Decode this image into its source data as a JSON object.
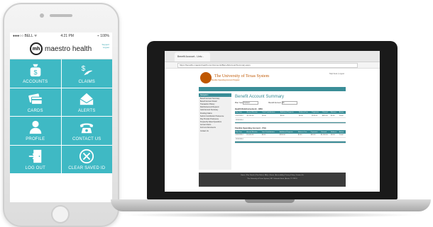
{
  "phone": {
    "status": {
      "carrier": "●●●○○ BELL ᯤ",
      "time": "4:21 PM",
      "battery": "⌁ 100%"
    },
    "brand": "maestro health",
    "logo_text": "mh",
    "menu_links": [
      "Support",
      "Logout"
    ],
    "tiles": [
      {
        "label": "ACCOUNTS",
        "icon": "money-bag-icon"
      },
      {
        "label": "CLAIMS",
        "icon": "hand-dollar-icon"
      },
      {
        "label": "CARDS",
        "icon": "credit-cards-icon"
      },
      {
        "label": "ALERTS",
        "icon": "envelope-icon"
      },
      {
        "label": "PROFILE",
        "icon": "person-icon"
      },
      {
        "label": "CONTACT US",
        "icon": "telephone-icon"
      },
      {
        "label": "LOG OUT",
        "icon": "logout-door-icon"
      },
      {
        "label": "CLEAR SAVED ID",
        "icon": "circle-x-icon"
      }
    ]
  },
  "laptop": {
    "tab_title": "Benefit Account - Univ...",
    "url": "https://benefits.maestrohealth.com/Accounts/BenefitAccountSummary.aspx",
    "org_title": "The University of Texas System",
    "org_subtitle": "Flexible Spending Account Program",
    "header_links": "Help Desk | Logout",
    "page_title": "Benefit Account Summary",
    "filters": {
      "plan_year_label": "Plan Year",
      "plan_year_value": "Current",
      "account_label": "Benefit Account",
      "account_value": "All"
    },
    "sidebar_header": "Navigation",
    "sidebar_items": [
      "Benefit Account Summary",
      "Benefit Account Detail",
      "Transaction History",
      "Reimbursement Request",
      "Card Account Summary",
      "Pending Claims",
      "Submit Contribution Preference",
      "Pay Provider Preference",
      "Frequently Asked Questions",
      "Account Alerts",
      "Forms & Documents",
      "Contact Us"
    ],
    "hsa_title": "Health Reimbursement - HRA",
    "fsa_title": "Flexible Spending Account - FSA",
    "table_headers": [
      "Plan Year",
      "Annual Election",
      "Total Contributions",
      "Additional Deposits",
      "Balance Due",
      "Payments",
      "Claimed",
      "Balance",
      "Action"
    ],
    "hsa_rows": [
      [
        "01/01/2014",
        "$1,200.00",
        "$0.00",
        "$0.00",
        "$0.00",
        "$574.00",
        "$626.00",
        "$0.00",
        "Detail"
      ],
      [
        "12/31/2014",
        "",
        "",
        "",
        "",
        "",
        "",
        "",
        ""
      ]
    ],
    "fsa_rows": [
      [
        "01/01/2014",
        "$1,000.00",
        "$0.00",
        "$200.00",
        "$0.00",
        "$50.00",
        "$1,050.00",
        "$0.00",
        "Detail"
      ],
      [
        "12/31/2014",
        "",
        "",
        "",
        "",
        "",
        "",
        "",
        ""
      ]
    ],
    "footer_line1": "Home | Plan Details | Plan Rules | FAQs | Forms | Accessibility | Privacy Policy | Contact Us",
    "footer_line2": "The University of Texas System | 601 Colorado Street | Austin, TX 78701"
  }
}
